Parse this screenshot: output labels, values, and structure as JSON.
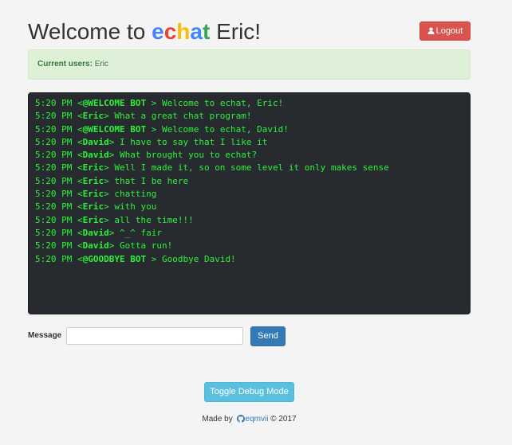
{
  "header": {
    "welcome_prefix": "Welcome to",
    "brand_letters": [
      {
        "char": "e",
        "color": "#4285f4"
      },
      {
        "char": "c",
        "color": "#ea4335"
      },
      {
        "char": "h",
        "color": "#fbbc05"
      },
      {
        "char": "a",
        "color": "#4285f4"
      },
      {
        "char": "t",
        "color": "#34a853"
      }
    ],
    "username": "Eric!",
    "logout_label": "Logout",
    "logout_icon": "user-icon"
  },
  "users": {
    "label": "Current users:",
    "list": "Eric"
  },
  "chat": {
    "text_color": "#2ef03a",
    "background": "#272b30",
    "messages": [
      {
        "time": "5:20 PM",
        "sender": "@WELCOME BOT",
        "suffix": " ",
        "text": "Welcome to echat, Eric!"
      },
      {
        "time": "5:20 PM",
        "sender": "Eric",
        "suffix": "",
        "text": "What a great chat program!"
      },
      {
        "time": "5:20 PM",
        "sender": "@WELCOME BOT",
        "suffix": " ",
        "text": "Welcome to echat, David!"
      },
      {
        "time": "5:20 PM",
        "sender": "David",
        "suffix": "",
        "text": "I have to say that I like it"
      },
      {
        "time": "5:20 PM",
        "sender": "David",
        "suffix": "",
        "text": "What brought you to echat?"
      },
      {
        "time": "5:20 PM",
        "sender": "Eric",
        "suffix": "",
        "text": "Well I made it, so on some level it only makes sense"
      },
      {
        "time": "5:20 PM",
        "sender": "Eric",
        "suffix": "",
        "text": "that I be here"
      },
      {
        "time": "5:20 PM",
        "sender": "Eric",
        "suffix": "",
        "text": "chatting"
      },
      {
        "time": "5:20 PM",
        "sender": "Eric",
        "suffix": "",
        "text": "with you"
      },
      {
        "time": "5:20 PM",
        "sender": "Eric",
        "suffix": "",
        "text": "all the time!!!"
      },
      {
        "time": "5:20 PM",
        "sender": "David",
        "suffix": "",
        "text": "^_^ fair"
      },
      {
        "time": "5:20 PM",
        "sender": "David",
        "suffix": "",
        "text": "Gotta run!"
      },
      {
        "time": "5:20 PM",
        "sender": "@GOODBYE BOT",
        "suffix": " ",
        "text": "Goodbye David!"
      }
    ]
  },
  "composer": {
    "label": "Message",
    "value": "",
    "placeholder": "",
    "send_label": "Send"
  },
  "debug": {
    "toggle_label": "Toggle Debug Mode"
  },
  "footer": {
    "made_by": "Made by",
    "github_icon": "github-icon",
    "author": "eqmvii",
    "copyright": "© 2017"
  }
}
